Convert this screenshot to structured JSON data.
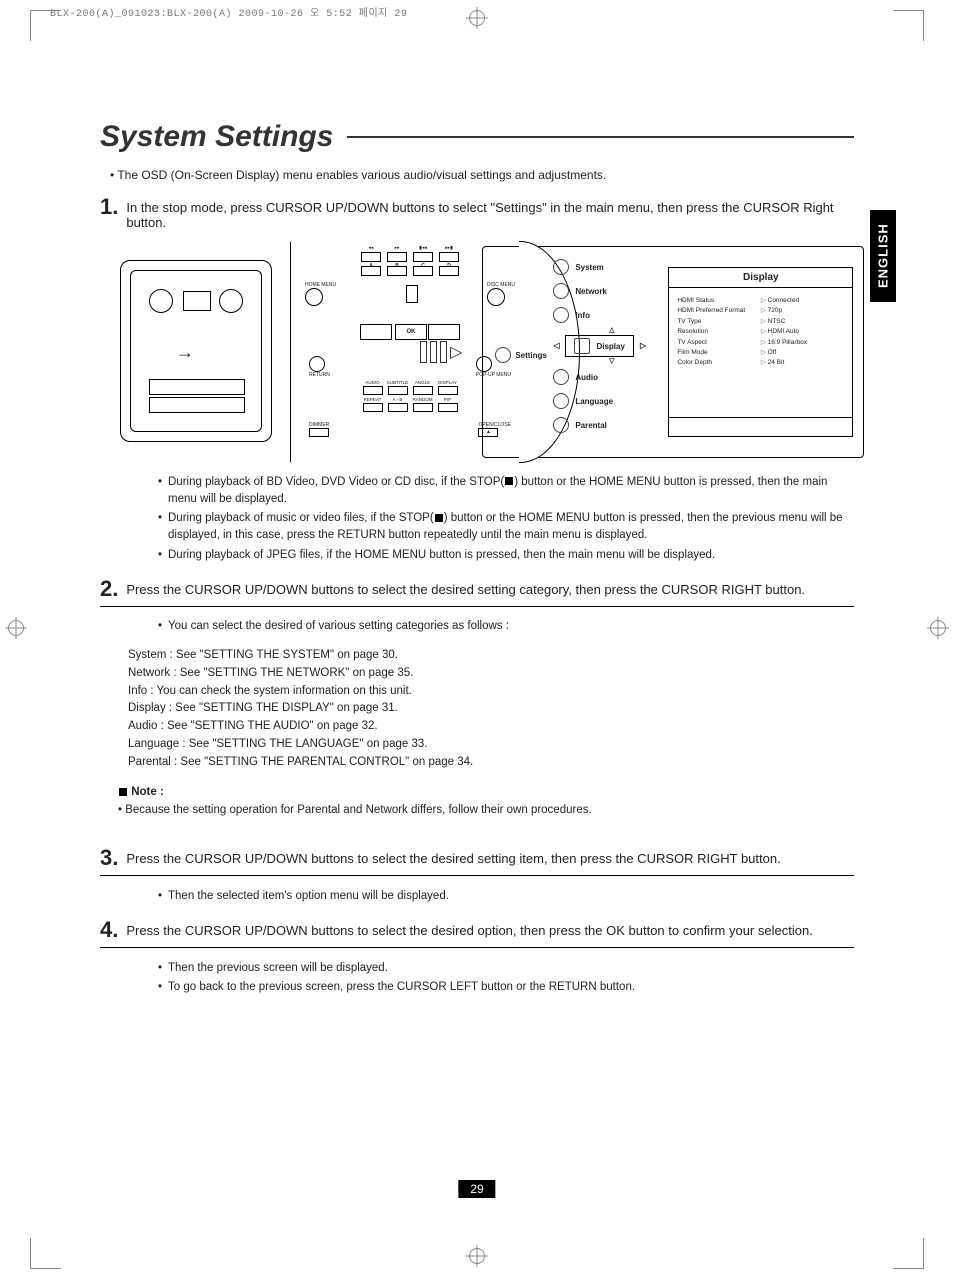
{
  "print_header": "BLX-200(A)_091023:BLX-200(A)  2009-10-26  오   5:52  페이지 29",
  "side_tab": "ENGLISH",
  "page_number": "29",
  "title": "System Settings",
  "intro_bullet": "The OSD (On-Screen Display) menu enables various audio/visual settings and adjustments.",
  "steps": {
    "s1": {
      "num": "1.",
      "text": "In the stop mode, press CURSOR UP/DOWN buttons to select \"Settings\" in the main menu, then press the CURSOR Right button."
    },
    "s2": {
      "num": "2.",
      "text": "Press the CURSOR UP/DOWN buttons to select the desired setting category, then press the CURSOR RIGHT button."
    },
    "s3": {
      "num": "3.",
      "text": "Press the CURSOR UP/DOWN buttons to select the desired setting item, then press the CURSOR RIGHT button."
    },
    "s4": {
      "num": "4.",
      "text": "Press the CURSOR UP/DOWN buttons to select the desired option, then press the OK button to confirm your selection."
    }
  },
  "after1": {
    "b1a": "During playback of BD Video, DVD Video or CD disc, if the STOP(",
    "b1b": ") button or the HOME MENU button is pressed, then the main menu will be displayed.",
    "b2a": "During playback of music or video files, if the STOP(",
    "b2b": ") button or the HOME MENU button is pressed, then the previous menu will be displayed, in this case, press the RETURN button repeatedly until the main menu is displayed.",
    "b3": "During playback of JPEG files, if the HOME MENU button is pressed, then the main menu will be displayed."
  },
  "after2": {
    "lead": "You can  select the desired of various setting categories as follows :",
    "lines": {
      "l1": "System : See \"SETTING THE SYSTEM\" on page 30.",
      "l2": "Network : See \"SETTING THE NETWORK\" on page 35.",
      "l3": "Info : You can check the system information on this unit.",
      "l4": "Display : See \"SETTING THE DISPLAY\" on page 31.",
      "l5": "Audio : See \"SETTING THE AUDIO\" on page 32.",
      "l6": "Language : See \"SETTING THE LANGUAGE\" on page 33.",
      "l7": "Parental : See \"SETTING THE PARENTAL CONTROL\" on page 34."
    },
    "note_label": "Note :",
    "note_text": "Because the setting operation for Parental and Network differs, follow their own procedures."
  },
  "after3": {
    "b1": "Then the selected item's option menu will be displayed."
  },
  "after4": {
    "b1": "Then the previous screen will be displayed.",
    "b2": "To go back to the previous screen, press the CURSOR LEFT button or the RETURN button."
  },
  "remote": {
    "topA": "A",
    "topB": "B",
    "topC": "C",
    "topD": "D",
    "home": "HOME MENU",
    "disc": "DISC MENU",
    "ok": "OK",
    "return": "RETURN",
    "popup": "POP-UP MENU",
    "r2a": "AUDIO",
    "r2b": "SUBTITLE",
    "r2c": "ANGLE",
    "r2d": "DISPLAY",
    "r3a": "REPEAT",
    "r3b": "A - B",
    "r3c": "RANDOM",
    "r3d": "PIP",
    "dimmer": "DIMMER",
    "open": "OPEN/CLOSE"
  },
  "osd": {
    "settings": "Settings",
    "menu": {
      "system": "System",
      "network": "Network",
      "info": "Info",
      "display": "Display",
      "audio": "Audio",
      "language": "Language",
      "parental": "Parental"
    },
    "panel_title": "Display",
    "left": {
      "l1": "HDMI Status",
      "l2": "HDMI Preferred Format",
      "l3": "TV Type",
      "l4": "Resolution",
      "l5": "TV Aspect",
      "l6": "Film Mode",
      "l7": "Color Depth"
    },
    "right": {
      "r1": "Connected",
      "r2": "720p",
      "r3": "NTSC",
      "r4": "HDMI Auto",
      "r5": "16:9 Pillarbox",
      "r6": "Off",
      "r7": "24 Bit"
    }
  }
}
